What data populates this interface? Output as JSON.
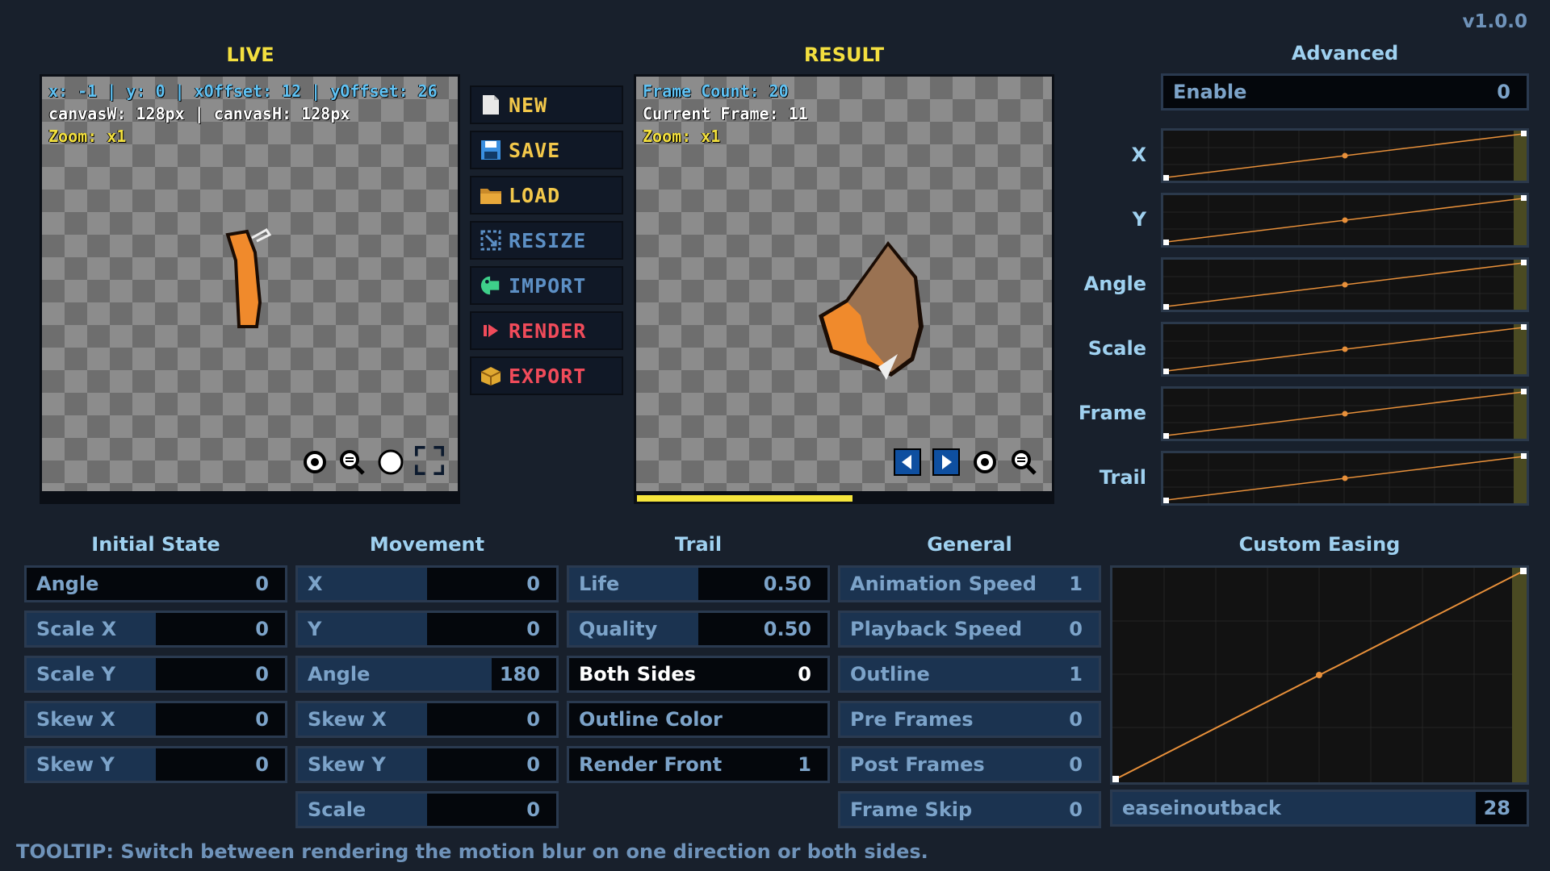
{
  "version": "v1.0.0",
  "live": {
    "title": "LIVE",
    "info_line1": "x: -1 | y: 0 | xOffset: 12 | yOffset: 26",
    "info_line2": "canvasW: 128px | canvasH: 128px",
    "zoom": "Zoom: x1"
  },
  "result": {
    "title": "RESULT",
    "frame_count": "Frame Count: 20",
    "current_frame": "Current Frame: 11",
    "zoom": "Zoom: x1",
    "progress": 0.52
  },
  "menu": [
    {
      "label": "NEW",
      "color": "#f3c84a"
    },
    {
      "label": "SAVE",
      "color": "#f3c84a"
    },
    {
      "label": "LOAD",
      "color": "#f3c84a"
    },
    {
      "label": "RESIZE",
      "color": "#5c8fc4"
    },
    {
      "label": "IMPORT",
      "color": "#5c8fc4"
    },
    {
      "label": "RENDER",
      "color": "#f04b5a"
    },
    {
      "label": "EXPORT",
      "color": "#f04b5a"
    }
  ],
  "advanced": {
    "title": "Advanced",
    "enable_label": "Enable",
    "enable_value": "0",
    "curves": [
      "X",
      "Y",
      "Angle",
      "Scale",
      "Frame",
      "Trail"
    ]
  },
  "sections": {
    "initial_state": "Initial State",
    "movement": "Movement",
    "trail": "Trail",
    "general": "General",
    "custom_easing": "Custom Easing"
  },
  "initial_state": [
    {
      "label": "Angle",
      "value": "0"
    },
    {
      "label": "Scale X",
      "value": "0"
    },
    {
      "label": "Scale Y",
      "value": "0"
    },
    {
      "label": "Skew X",
      "value": "0"
    },
    {
      "label": "Skew Y",
      "value": "0"
    }
  ],
  "movement": [
    {
      "label": "X",
      "value": "0"
    },
    {
      "label": "Y",
      "value": "0"
    },
    {
      "label": "Angle",
      "value": "180"
    },
    {
      "label": "Skew X",
      "value": "0"
    },
    {
      "label": "Skew Y",
      "value": "0"
    },
    {
      "label": "Scale",
      "value": "0"
    }
  ],
  "trail": [
    {
      "label": "Life",
      "value": "0.50"
    },
    {
      "label": "Quality",
      "value": "0.50"
    },
    {
      "label": "Both Sides",
      "value": "0"
    },
    {
      "label": "Outline Color",
      "value": ""
    },
    {
      "label": "Render Front",
      "value": "1"
    }
  ],
  "general": [
    {
      "label": "Animation Speed",
      "value": "1"
    },
    {
      "label": "Playback Speed",
      "value": "0"
    },
    {
      "label": "Outline",
      "value": "1"
    },
    {
      "label": "Pre Frames",
      "value": "0"
    },
    {
      "label": "Post Frames",
      "value": "0"
    },
    {
      "label": "Frame Skip",
      "value": "0"
    }
  ],
  "easing": {
    "name": "easeinoutback",
    "value": "28"
  },
  "tooltip": "TOOLTIP: Switch between rendering the motion blur on one direction or both sides.",
  "colors": {
    "background": "#18202c",
    "accent_yellow": "#f3df3f",
    "curve_line": "#e8903a",
    "progress": "#f5e53c"
  }
}
